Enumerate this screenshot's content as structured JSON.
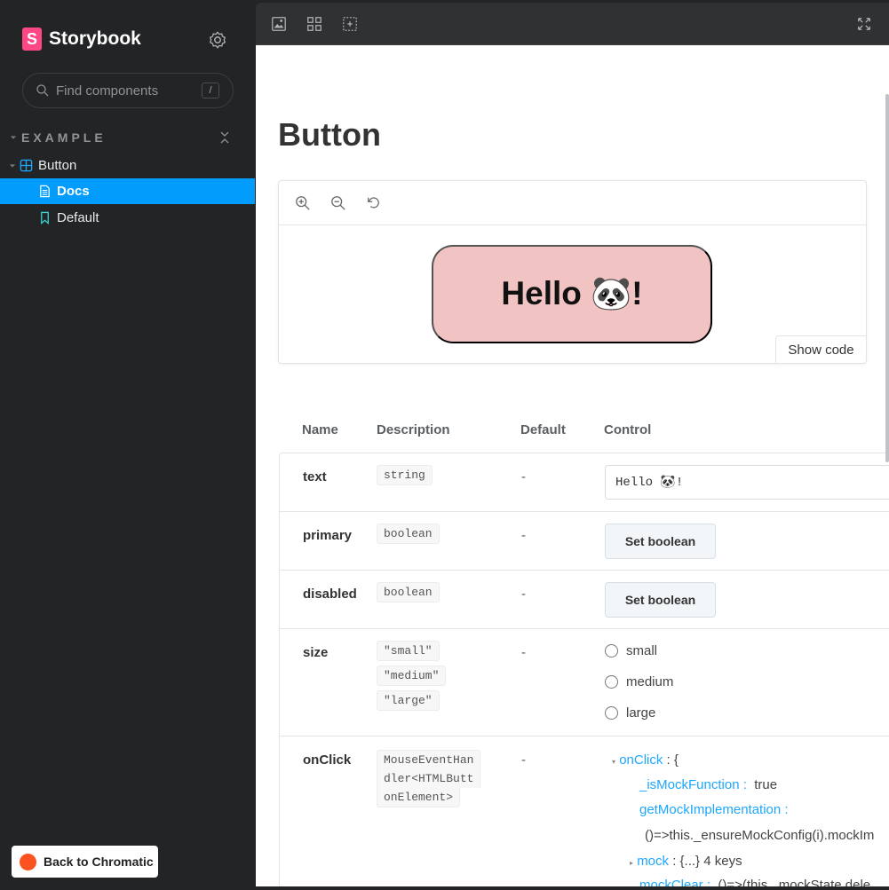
{
  "sidebar": {
    "brand": "Storybook",
    "logo_letter": "S",
    "search_placeholder": "Find components",
    "search_shortcut": "/",
    "group": "EXAMPLE",
    "component": "Button",
    "docs": "Docs",
    "default": "Default",
    "back_label": "Back to Chromatic"
  },
  "toolbar": {
    "icons": [
      "image-icon",
      "grid-icon",
      "outline-icon",
      "fullscreen-icon"
    ]
  },
  "docs": {
    "title": "Button",
    "demo_text": "Hello 🐼!",
    "show_code": "Show code",
    "headers": [
      "Name",
      "Description",
      "Default",
      "Control"
    ],
    "rows": [
      {
        "name": "text",
        "types": [
          "string"
        ],
        "default": "-",
        "control": "Hello 🐼!"
      },
      {
        "name": "primary",
        "types": [
          "boolean"
        ],
        "default": "-",
        "control": "Set boolean"
      },
      {
        "name": "disabled",
        "types": [
          "boolean"
        ],
        "default": "-",
        "control": "Set boolean"
      },
      {
        "name": "size",
        "types": [
          "\"small\"",
          "\"medium\"",
          "\"large\""
        ],
        "default": "-",
        "options": [
          "small",
          "medium",
          "large"
        ]
      },
      {
        "name": "onClick",
        "types": [
          "MouseEventHan",
          "dler<HTMLButt",
          "onElement>"
        ],
        "default": "-"
      }
    ],
    "onclick_tree": {
      "root": "onClick",
      "root_suffix": ": {",
      "is_mock_key": "_isMockFunction :",
      "is_mock_value": "true",
      "get_impl_key": "getMockImplementation :",
      "get_impl_value": "()=>this._ensureMockConfig(i).mockIm",
      "mock_key": "mock",
      "mock_value": ": {...} 4 keys",
      "mock_clear_key": "mockClear :",
      "mock_clear_value": "()=>(this._mockState.dele"
    }
  }
}
